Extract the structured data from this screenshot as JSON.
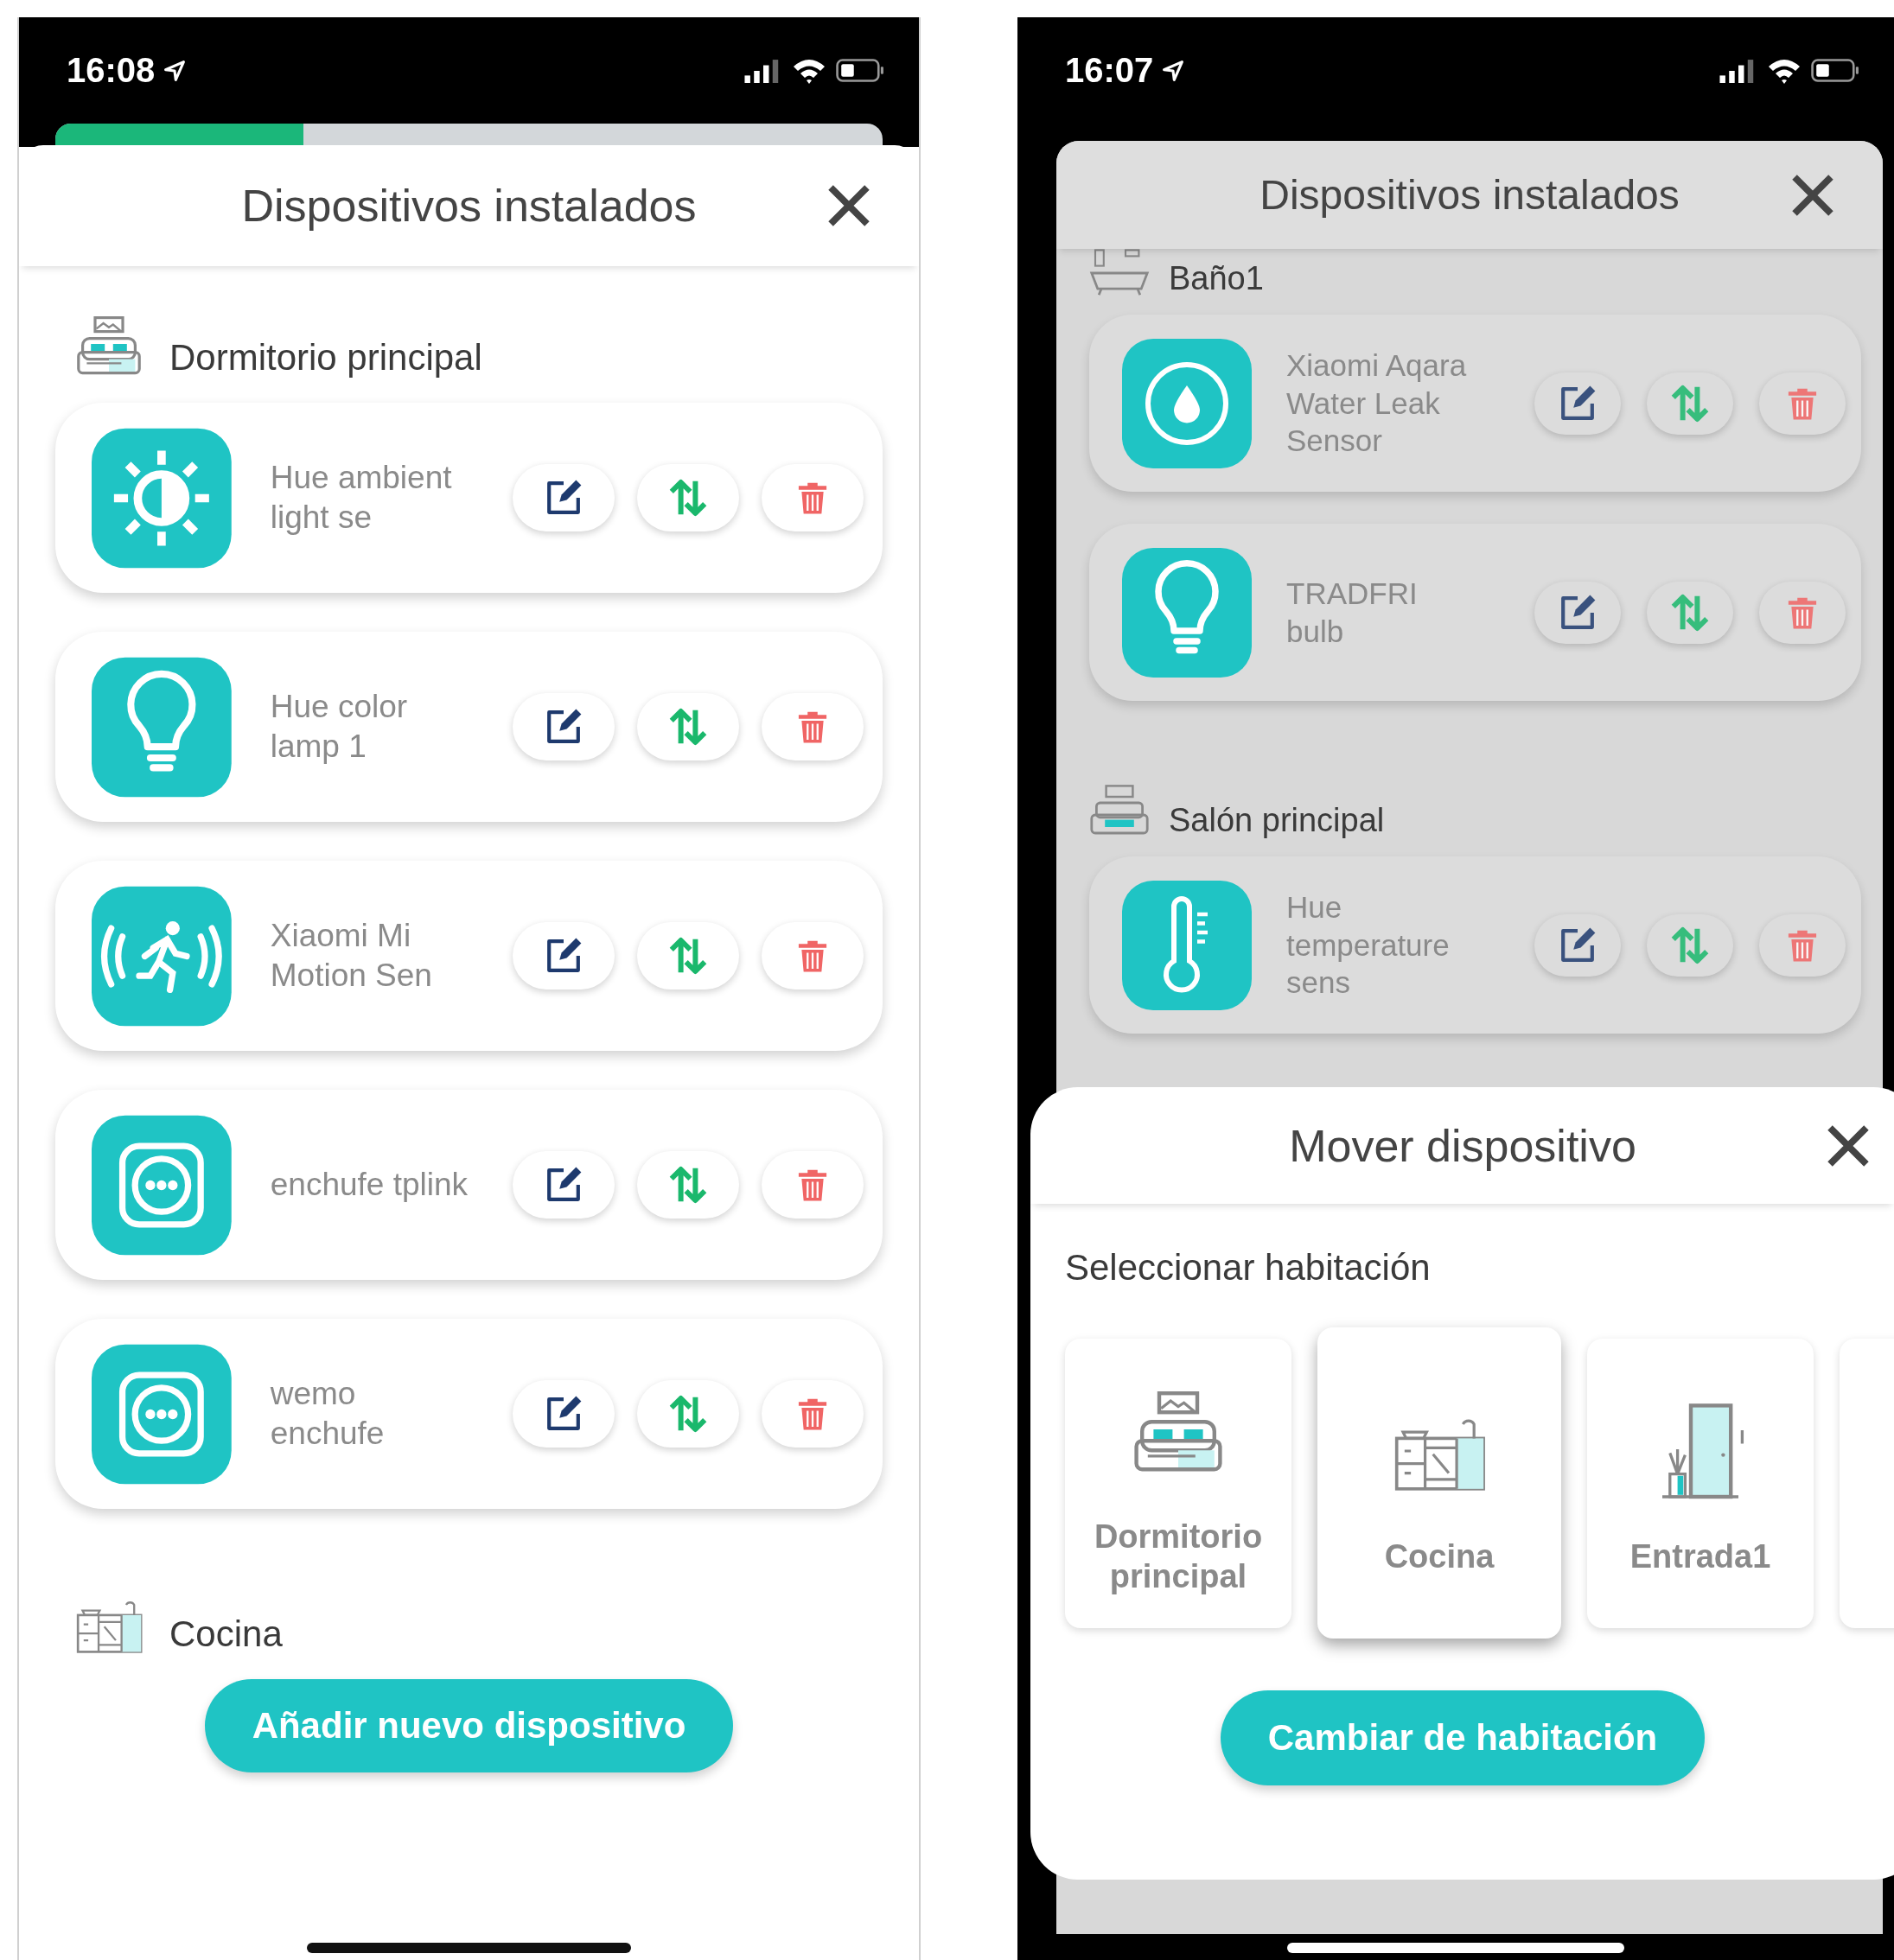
{
  "left_screen": {
    "status_bar": {
      "time": "16:08"
    },
    "progress": {
      "level": 0.3
    },
    "sheet": {
      "title": "Dispositivos instalados",
      "rooms": [
        {
          "name": "Dormitorio principal",
          "kind": "bedroom",
          "devices": [
            {
              "name": "Hue ambient light se",
              "kind": "ambient"
            },
            {
              "name": "Hue color lamp 1",
              "kind": "bulb"
            },
            {
              "name": "Xiaomi Mi Motion Sen",
              "kind": "motion"
            },
            {
              "name": "enchufe tplink",
              "kind": "socket"
            },
            {
              "name": "wemo enchufe",
              "kind": "socket"
            }
          ]
        },
        {
          "name": "Cocina",
          "kind": "kitchen"
        }
      ],
      "button": "Añadir nuevo dispositivo"
    }
  },
  "right_screen": {
    "status_bar": {
      "time": "16:07"
    },
    "sheet": {
      "title": "Dispositivos instalados",
      "rooms": [
        {
          "name": "Baño1",
          "kind": "bathroom",
          "devices": [
            {
              "name": "Xiaomi Aqara Water Leak Sensor",
              "kind": "leak"
            },
            {
              "name": "TRADFRI bulb",
              "kind": "bulb"
            }
          ]
        },
        {
          "name": "Salón principal",
          "kind": "living",
          "devices": [
            {
              "name": "Hue temperature sens",
              "kind": "thermometer"
            }
          ]
        }
      ]
    },
    "move_dialog": {
      "title": "Mover dispositivo",
      "subtitle": "Seleccionar habitación",
      "rooms": [
        {
          "name": "Dormitorio principal",
          "kind": "bedroom",
          "selected": false
        },
        {
          "name": "Cocina",
          "kind": "kitchen",
          "selected": true
        },
        {
          "name": "Entrada1",
          "kind": "entrance",
          "selected": false
        }
      ],
      "button": "Cambiar de habitación"
    }
  }
}
